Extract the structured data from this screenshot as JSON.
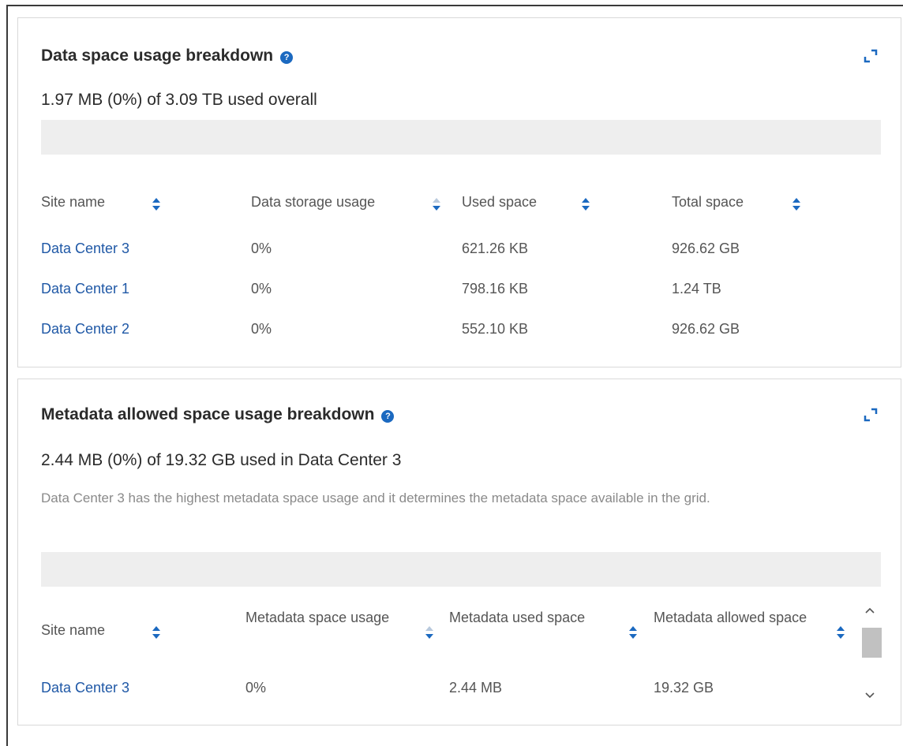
{
  "data_space": {
    "title": "Data space usage breakdown",
    "help_icon": "question-circle-icon",
    "summary": "1.97 MB (0%) of 3.09 TB used overall",
    "columns": [
      "Site name",
      "Data storage usage",
      "Used space",
      "Total space"
    ],
    "rows": [
      {
        "site": "Data Center 3",
        "usage": "0%",
        "used": "621.26 KB",
        "total": "926.62 GB"
      },
      {
        "site": "Data Center 1",
        "usage": "0%",
        "used": "798.16 KB",
        "total": "1.24 TB"
      },
      {
        "site": "Data Center 2",
        "usage": "0%",
        "used": "552.10 KB",
        "total": "926.62 GB"
      }
    ]
  },
  "metadata_space": {
    "title": "Metadata allowed space usage breakdown",
    "help_icon": "question-circle-icon",
    "summary": "2.44 MB (0%) of 19.32 GB used in Data Center 3",
    "note": "Data Center 3 has the highest metadata space usage and it determines the metadata space available in the grid.",
    "columns": [
      "Site name",
      "Metadata space usage",
      "Metadata used space",
      "Metadata allowed space"
    ],
    "rows": [
      {
        "site": "Data Center 3",
        "usage": "0%",
        "used": "2.44 MB",
        "allowed": "19.32 GB"
      }
    ]
  },
  "colors": {
    "link": "#1f58a6",
    "help": "#1b69c0",
    "sort_active": "#1b69c0",
    "sort_inactive": "#b8c9dd"
  }
}
